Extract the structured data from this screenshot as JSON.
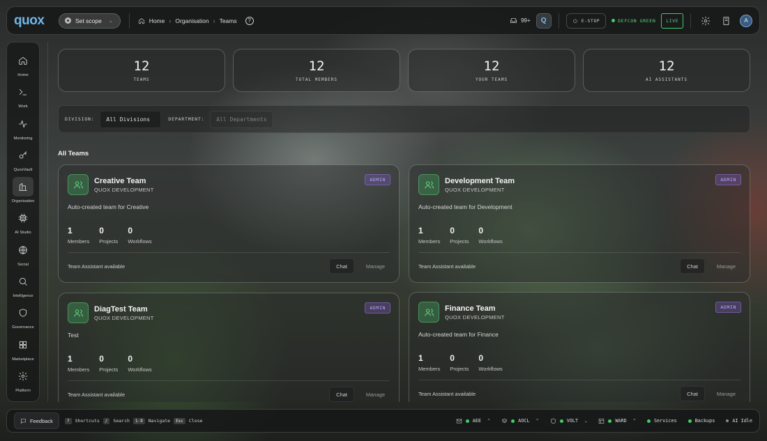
{
  "app": {
    "logo": "quox"
  },
  "topbar": {
    "scope_label": "Set scope",
    "breadcrumbs": [
      "Home",
      "Organisation",
      "Teams"
    ],
    "inbox_count": "99+",
    "q_label": "Q",
    "estop_label": "E-STOP",
    "defcon_label": "DEFCON GREEN",
    "live_label": "LIVE",
    "avatar_initial": "A"
  },
  "sidebar": {
    "items": [
      {
        "label": "Home",
        "icon": "home-icon"
      },
      {
        "label": "Work",
        "icon": "terminal-icon"
      },
      {
        "label": "Monitoring",
        "icon": "activity-icon"
      },
      {
        "label": "QuoxVault",
        "icon": "key-icon"
      },
      {
        "label": "Organisation",
        "icon": "building-icon"
      },
      {
        "label": "AI Studio",
        "icon": "chip-icon"
      },
      {
        "label": "Social",
        "icon": "globe-icon"
      },
      {
        "label": "Intelligence",
        "icon": "search-icon"
      },
      {
        "label": "Governance",
        "icon": "shield-icon"
      },
      {
        "label": "Marketplace",
        "icon": "grid-icon"
      },
      {
        "label": "Platform",
        "icon": "gear-icon"
      }
    ],
    "active": "Organisation"
  },
  "stats": [
    {
      "value": "12",
      "label": "TEAMS"
    },
    {
      "value": "12",
      "label": "TOTAL MEMBERS"
    },
    {
      "value": "12",
      "label": "YOUR TEAMS"
    },
    {
      "value": "12",
      "label": "AI ASSISTANTS"
    }
  ],
  "filters": {
    "division_label": "DIVISION:",
    "division_value": "All Divisions",
    "department_label": "DEPARTMENT:",
    "department_value": "All Departments"
  },
  "section_title": "All Teams",
  "teams": [
    {
      "name": "Creative Team",
      "division": "QUOX DEVELOPMENT",
      "role": "ADMIN",
      "description": "Auto-created team for Creative",
      "members": "1",
      "projects": "0",
      "workflows": "0"
    },
    {
      "name": "Development Team",
      "division": "QUOX DEVELOPMENT",
      "role": "ADMIN",
      "description": "Auto-created team for Development",
      "members": "1",
      "projects": "0",
      "workflows": "0"
    },
    {
      "name": "DiagTest Team",
      "division": "QUOX DEVELOPMENT",
      "role": "ADMIN",
      "description": "Test",
      "members": "1",
      "projects": "0",
      "workflows": "0"
    },
    {
      "name": "Finance Team",
      "division": "QUOX DEVELOPMENT",
      "role": "ADMIN",
      "description": "Auto-created team for Finance",
      "members": "1",
      "projects": "0",
      "workflows": "0"
    }
  ],
  "card_labels": {
    "members": "Members",
    "projects": "Projects",
    "workflows": "Workflows",
    "assistant": "Team Assistant available",
    "chat": "Chat",
    "manage": "Manage"
  },
  "bottombar": {
    "feedback": "Feedback",
    "shortcuts": [
      {
        "key": "?",
        "label": "Shortcuts"
      },
      {
        "key": "/",
        "label": "Search"
      },
      {
        "key": "1-9",
        "label": "Navigate"
      },
      {
        "key": "Esc",
        "label": "Close"
      }
    ],
    "status": [
      "AEE",
      "AOCL",
      "VOLT",
      "WARD"
    ],
    "services": "Services",
    "backups": "Backups",
    "ai_status": "AI Idle"
  },
  "colors": {
    "accent": "#6fb7e8",
    "ok": "#3fcf6a",
    "admin": "#b9a6ff"
  }
}
